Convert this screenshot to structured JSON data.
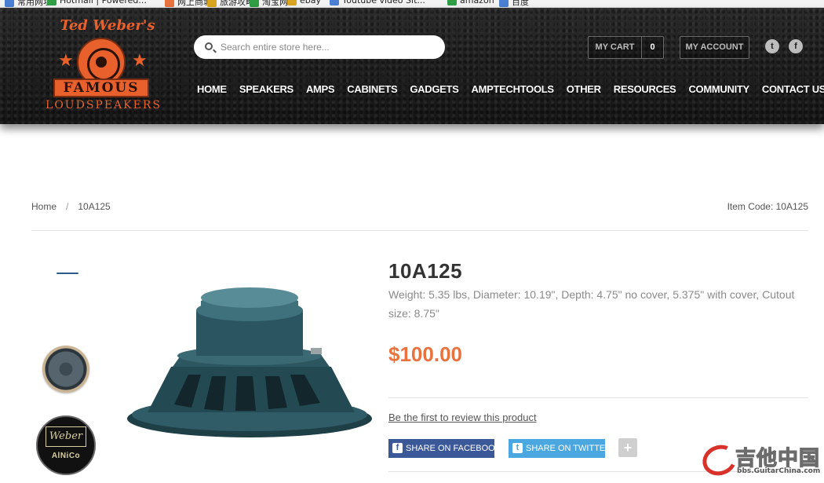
{
  "browser": {
    "bookmarks": [
      {
        "label": "常用网址",
        "color": "#4a7fd4"
      },
      {
        "label": "Hotmail | Powered...",
        "color": "#2f9e44"
      },
      {
        "label": "网上商城",
        "color": "#e8733f"
      },
      {
        "label": "旅游攻略",
        "color": "#d9a520"
      },
      {
        "label": "淘宝网",
        "color": "#2f9e44"
      },
      {
        "label": "ebay",
        "color": "#d9a520"
      },
      {
        "label": "Youtube video Sit...",
        "color": "#4a7fd4"
      },
      {
        "label": "amazon",
        "color": "#2f9e44"
      },
      {
        "label": "百度",
        "color": "#4a7fd4"
      }
    ]
  },
  "brand": {
    "script": "Ted Weber's",
    "band": "FAMOUS",
    "sub": "LOUDSPEAKERS",
    "accent": "#e8612c"
  },
  "search": {
    "placeholder": "Search entire store here..."
  },
  "cart": {
    "label": "MY CART",
    "count": "0"
  },
  "account": {
    "label": "MY ACCOUNT"
  },
  "social": {
    "twitter": "t",
    "facebook": "f"
  },
  "nav": [
    "HOME",
    "SPEAKERS",
    "AMPS",
    "CABINETS",
    "GADGETS",
    "AMPTECHTOOLS",
    "OTHER",
    "RESOURCES",
    "COMMUNITY",
    "CONTACT US"
  ],
  "breadcrumb": {
    "home": "Home",
    "separator": "/",
    "current": "10A125"
  },
  "item_code": "Item Code: 10A125",
  "thumbnails": {
    "badge_brand": "Weber",
    "badge_label": "AlNiCo"
  },
  "product": {
    "title": "10A125",
    "description": "Weight: 5.35 lbs, Diameter: 10.19\", Depth: 4.75\" no cover, 5.375\" with cover, Cutout size: 8.75\"",
    "price": "$100.00",
    "review_link": "Be the first to review this product",
    "price_color": "#e8733f"
  },
  "share": {
    "facebook_label": "SHARE ON FACEBOOK",
    "twitter_label": "SHARE ON TWITTER",
    "more_label": "+"
  },
  "watermark": {
    "title": "吉他中国",
    "url": "bbs.GuitarChina.com"
  }
}
